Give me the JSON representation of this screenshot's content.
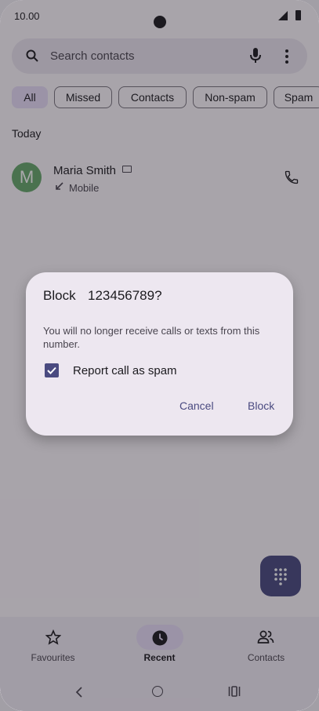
{
  "status_bar": {
    "time": "10.00"
  },
  "search": {
    "placeholder": "Search contacts"
  },
  "filters": [
    {
      "label": "All",
      "selected": true
    },
    {
      "label": "Missed",
      "selected": false
    },
    {
      "label": "Contacts",
      "selected": false
    },
    {
      "label": "Non-spam",
      "selected": false
    },
    {
      "label": "Spam",
      "selected": false
    }
  ],
  "section_header": "Today",
  "call_log": [
    {
      "avatar_letter": "M",
      "name": "Maria Smith",
      "type": "Mobile",
      "avatar_color": "#67a86b"
    }
  ],
  "dialog": {
    "title": "Block",
    "number": "123456789?",
    "message": "You will no longer receive calls or texts from this number.",
    "checkbox_label": "Report call as spam",
    "checkbox_checked": true,
    "cancel": "Cancel",
    "confirm": "Block"
  },
  "bottom_nav": {
    "items": [
      {
        "label": "Favourites",
        "icon": "star-icon",
        "active": false
      },
      {
        "label": "Recent",
        "icon": "clock-icon",
        "active": true
      },
      {
        "label": "Contacts",
        "icon": "people-icon",
        "active": false
      }
    ]
  },
  "colors": {
    "accent": "#4a4a80",
    "avatar": "#67a86b",
    "dialog_bg": "#ede7f0"
  }
}
